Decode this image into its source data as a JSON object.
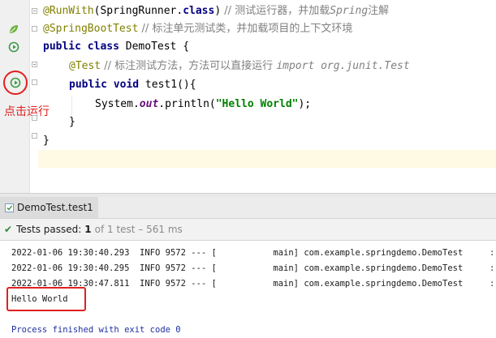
{
  "editor": {
    "lines": [
      {
        "id": "l1",
        "annotation": "@RunWith",
        "paren_open": "(",
        "klass": "SpringRunner",
        "dot": ".",
        "kw": "class",
        "paren_close": ")",
        "comment": " // 测试运行器，并加载",
        "comment_it": "Spring",
        "comment_tail": "注解"
      },
      {
        "id": "l2",
        "annotation": "@SpringBootTest",
        "comment": " // 标注单元测试类，并加载项目的上下文环境"
      },
      {
        "id": "l3",
        "kw1": "public",
        "kw2": "class",
        "rest": " DemoTest {"
      },
      {
        "id": "l4",
        "annotation": "@Test",
        "comment": " // 标注测试方法，方法可以直接运行 ",
        "comment_it": "import org.junit.Test"
      },
      {
        "id": "l5",
        "kw1": "public",
        "kw2": "void",
        "rest": " test1(){"
      },
      {
        "id": "l6",
        "pre": "System.",
        "field": "out",
        "mid": ".println(",
        "str": "\"Hello World\"",
        "post": ");"
      },
      {
        "id": "l7",
        "rest": "}"
      },
      {
        "id": "l8",
        "rest": "}"
      }
    ],
    "click_run_label": "点击运行",
    "icons": [
      "spring-bean-icon",
      "run-class-icon",
      "run-test-icon"
    ]
  },
  "run_tab": {
    "label": "DemoTest.test1"
  },
  "status": {
    "label": "Tests passed:",
    "count": "1",
    "detail": "of 1 test – 561 ms"
  },
  "console": {
    "lines": [
      "2022-01-06 19:30:40.293  INFO 9572 --- [           main] com.example.springdemo.DemoTest",
      "2022-01-06 19:30:40.295  INFO 9572 --- [           main] com.example.springdemo.DemoTest",
      "2022-01-06 19:30:47.811  INFO 9572 --- [           main] com.example.springdemo.DemoTest"
    ],
    "edge_char": ":",
    "output": "Hello World",
    "finished": "Process finished with exit code 0"
  },
  "colors": {
    "annotation": "#808000",
    "keyword": "#000080",
    "comment": "#808080",
    "string": "#008000",
    "highlight": "#e02020",
    "pass": "#2e8b3a"
  }
}
